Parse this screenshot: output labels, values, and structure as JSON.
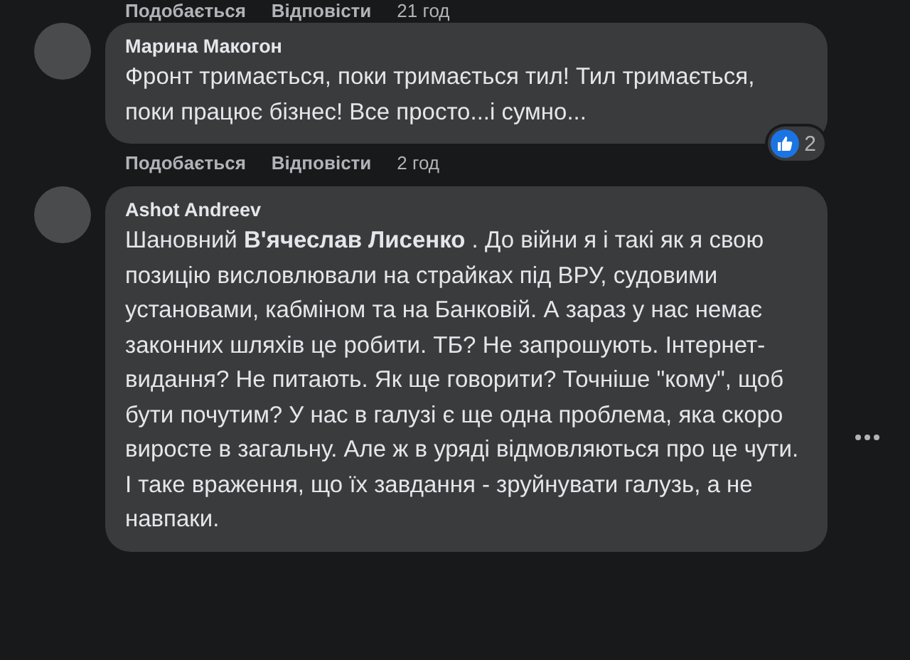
{
  "previous_comment_actions": [
    {
      "kind": "link",
      "text": "Подобається"
    },
    {
      "kind": "link",
      "text": "Відповісти"
    },
    {
      "kind": "time",
      "text": "21 год"
    }
  ],
  "comments": [
    {
      "author": "Марина Макогон",
      "text": "Фронт тримається, поки тримається тил! Тил тримається, поки працює бізнес! Все просто...і сумно...",
      "reactions": {
        "count": "2"
      },
      "actions": [
        {
          "kind": "link",
          "text": "Подобається"
        },
        {
          "kind": "link",
          "text": "Відповісти"
        },
        {
          "kind": "time",
          "text": "2 год"
        }
      ]
    },
    {
      "author": "Ashot Andreev",
      "text": "Шановний **В'ячеслав Лисенко** . До війни я і такі як я свою позицію висловлювали на страйках під ВРУ, судовими установами, кабміном та на Банковій. А зараз у нас немає законних шляхів це робити. ТБ? Не запрошують. Інтернет-видання? Не питають. Як ще говорити? Точніше \"кому\", щоб бути почутим? У нас в галузі є ще одна проблема, яка скоро виросте в загальну. Але ж в уряді відмовляються про це чути. І таке враження, що їх завдання - зруйнувати галузь, а не навпаки."
    }
  ]
}
